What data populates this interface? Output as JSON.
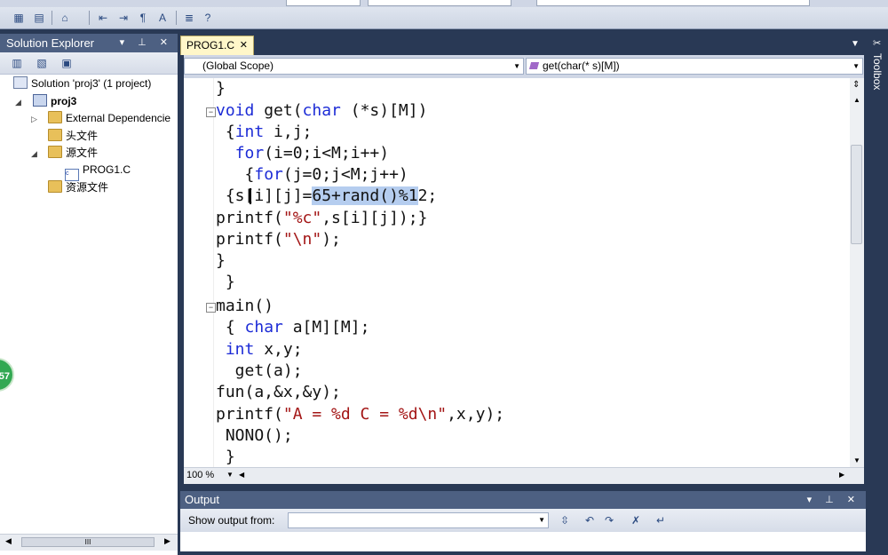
{
  "solution_explorer": {
    "title": "Solution Explorer",
    "items": [
      {
        "label": "Solution 'proj3' (1 project)"
      },
      {
        "label": "proj3"
      },
      {
        "label": "External Dependencie"
      },
      {
        "label": "头文件"
      },
      {
        "label": "源文件"
      },
      {
        "label": "PROG1.C"
      },
      {
        "label": "资源文件"
      }
    ],
    "scroll_label": "III"
  },
  "editor": {
    "tab_label": "PROG1.C",
    "scope_combo": "(Global Scope)",
    "member_combo": "get(char(* s)[M])",
    "zoom": "100 %",
    "code_lines": [
      "}",
      "void get(char (*s)[M])",
      " {int i,j;",
      "  for(i=0;i<M;i++)",
      "   {for(j=0;j<M;j++)",
      " {s[i][j]=65+rand()%12;",
      "printf(\"%c\",s[i][j]);}",
      "printf(\"\\n\");",
      "}",
      " }",
      "main()",
      " { char a[M][M];",
      " int x,y;",
      "  get(a);",
      "fun(a,&x,&y);",
      "printf(\"A = %d C = %d\\n\",x,y);",
      " NONO();",
      " }"
    ]
  },
  "output": {
    "title": "Output",
    "show_output_label": "Show output from:",
    "show_output_value": ""
  },
  "toolbox": {
    "label": "Toolbox"
  },
  "badge": {
    "text": "57"
  },
  "colors": {
    "keyword": "#1c2bd6",
    "string": "#a31515",
    "selection": "#b5cdef",
    "panel_title": "#4d6082"
  }
}
